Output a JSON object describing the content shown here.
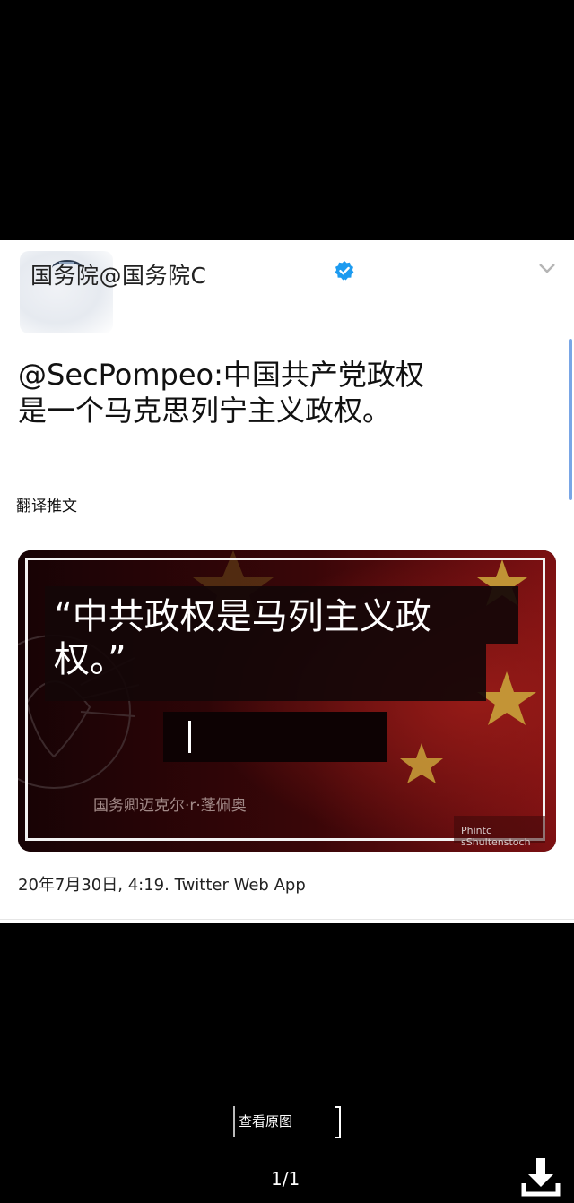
{
  "tweet": {
    "account_name": "国务院@国务院C",
    "text_line1": "@SecPompeo:中国共产党政权",
    "text_line2": "是一个马克思列宁主义政权。",
    "translate_label": "翻译推文",
    "timestamp": "20年7月30日, 4:19. Twitter Web App"
  },
  "media": {
    "quote_line1": "“中共政权是马列主义政",
    "quote_line2": "权。”",
    "attribution": "国务卿迈克尔·r·蓬佩奥",
    "credit": "Phintc sShultenstoch"
  },
  "viewer": {
    "view_original_label": "查看原图",
    "page_indicator": "1/1"
  },
  "colors": {
    "verified": "#1d9bf0",
    "flag_red": "#8b1010",
    "star_gold": "#c9a23a"
  },
  "icons": {
    "verified": "verified-badge-icon",
    "chevron": "chevron-down-icon",
    "download": "download-icon"
  }
}
